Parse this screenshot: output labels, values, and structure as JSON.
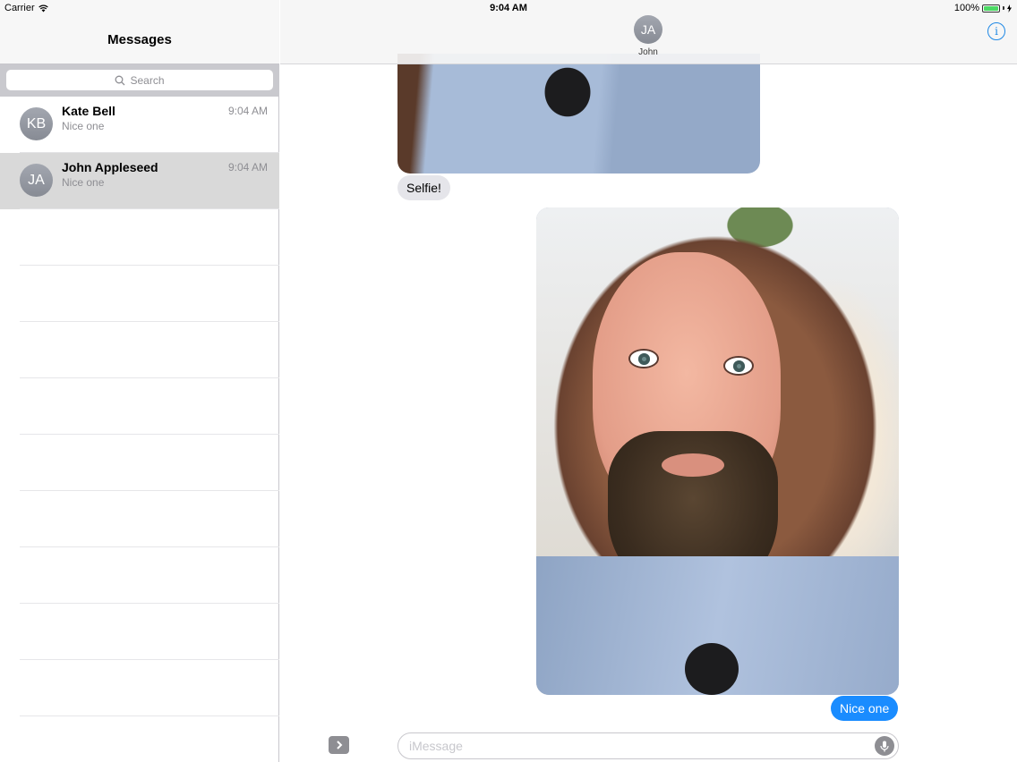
{
  "status_bar": {
    "carrier": "Carrier",
    "time": "9:04 AM",
    "battery": "100%",
    "battery_level": 1.0
  },
  "sidebar": {
    "title": "Messages",
    "search_placeholder": "Search",
    "conversations": [
      {
        "initials": "KB",
        "name": "Kate Bell",
        "time": "9:04 AM",
        "preview": "Nice one",
        "selected": false
      },
      {
        "initials": "JA",
        "name": "John Appleseed",
        "time": "9:04 AM",
        "preview": "Nice one",
        "selected": true
      }
    ]
  },
  "conversation": {
    "contact_initials": "JA",
    "contact_name": "John",
    "messages": [
      {
        "type": "image",
        "direction": "incoming"
      },
      {
        "type": "text",
        "direction": "incoming",
        "text": "Selfie!"
      },
      {
        "type": "image",
        "direction": "outgoing"
      },
      {
        "type": "text",
        "direction": "outgoing",
        "text": "Nice one"
      }
    ],
    "compose_placeholder": "iMessage"
  },
  "colors": {
    "outgoing_bubble": "#1a8cff",
    "incoming_bubble": "#e5e5ea",
    "accent": "#1e88e5"
  }
}
